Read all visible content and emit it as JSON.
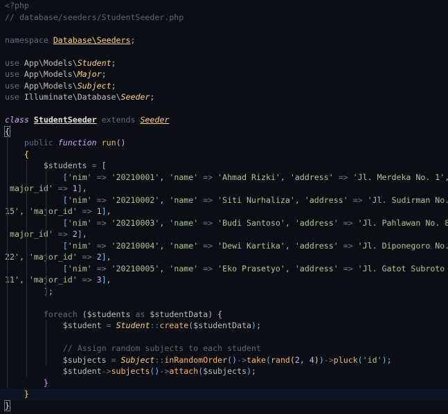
{
  "editor": {
    "lines": [
      [
        {
          "t": "<?php",
          "c": "c-comment"
        }
      ],
      [
        {
          "t": "// database/seeders/StudentSeeder.php",
          "c": "c-comment"
        }
      ],
      [],
      [
        {
          "t": "namespace ",
          "c": "c-kw"
        },
        {
          "t": "Database\\Seeders",
          "c": "c-ns"
        },
        {
          "t": ";",
          "c": "c-punc"
        }
      ],
      [],
      [
        {
          "t": "use ",
          "c": "c-kw"
        },
        {
          "t": "App\\Models\\",
          "c": "c-ident"
        },
        {
          "t": "Student",
          "c": "c-cls"
        },
        {
          "t": ";",
          "c": "c-punc"
        }
      ],
      [
        {
          "t": "use ",
          "c": "c-kw"
        },
        {
          "t": "App\\Models\\",
          "c": "c-ident"
        },
        {
          "t": "Major",
          "c": "c-cls"
        },
        {
          "t": ";",
          "c": "c-punc"
        }
      ],
      [
        {
          "t": "use ",
          "c": "c-kw"
        },
        {
          "t": "App\\Models\\",
          "c": "c-ident"
        },
        {
          "t": "Subject",
          "c": "c-cls"
        },
        {
          "t": ";",
          "c": "c-punc"
        }
      ],
      [
        {
          "t": "use ",
          "c": "c-kw"
        },
        {
          "t": "Illuminate\\Database\\",
          "c": "c-ident"
        },
        {
          "t": "Seeder",
          "c": "c-cls"
        },
        {
          "t": ";",
          "c": "c-punc"
        }
      ],
      [],
      [
        {
          "t": "class ",
          "c": "c-kwi"
        },
        {
          "t": "StudentSeeder",
          "c": "c-clsdef"
        },
        {
          "t": " extends ",
          "c": "c-kw"
        },
        {
          "t": "Seeder",
          "c": "c-clsu"
        }
      ],
      [
        {
          "t": "{",
          "c": "c-brace cursor-brace"
        }
      ],
      [
        {
          "t": "    public ",
          "c": "c-kw"
        },
        {
          "t": "function ",
          "c": "c-kwi"
        },
        {
          "t": "run",
          "c": "c-fn"
        },
        {
          "t": "()",
          "c": "c-bracket2"
        }
      ],
      [
        {
          "t": "    {",
          "c": "c-bracket1"
        }
      ],
      [
        {
          "t": "        $students",
          "c": "c-var"
        },
        {
          "t": " = ",
          "c": "c-op"
        },
        {
          "t": "[",
          "c": "c-bracket2"
        }
      ],
      [
        {
          "t": "            [",
          "c": "c-bracket3"
        },
        {
          "t": "'nim'",
          "c": "c-str"
        },
        {
          "t": " => ",
          "c": "c-op"
        },
        {
          "t": "'20210001'",
          "c": "c-str"
        },
        {
          "t": ", ",
          "c": "c-punc"
        },
        {
          "t": "'name'",
          "c": "c-str"
        },
        {
          "t": " => ",
          "c": "c-op"
        },
        {
          "t": "'Ahmad Rizki'",
          "c": "c-str"
        },
        {
          "t": ", ",
          "c": "c-punc"
        },
        {
          "t": "'address'",
          "c": "c-str"
        },
        {
          "t": " => ",
          "c": "c-op"
        },
        {
          "t": "'Jl. Merdeka No. 1'",
          "c": "c-str"
        },
        {
          "t": ",",
          "c": "c-punc"
        }
      ],
      [
        {
          "t": "'major_id'",
          "c": "c-str"
        },
        {
          "t": " => ",
          "c": "c-op"
        },
        {
          "t": "1",
          "c": "c-num"
        },
        {
          "t": "]",
          "c": "c-bracket3"
        },
        {
          "t": ",",
          "c": "c-punc"
        }
      ],
      [
        {
          "t": "            [",
          "c": "c-bracket3"
        },
        {
          "t": "'nim'",
          "c": "c-str"
        },
        {
          "t": " => ",
          "c": "c-op"
        },
        {
          "t": "'20210002'",
          "c": "c-str"
        },
        {
          "t": ", ",
          "c": "c-punc"
        },
        {
          "t": "'name'",
          "c": "c-str"
        },
        {
          "t": " => ",
          "c": "c-op"
        },
        {
          "t": "'Siti Nurhaliza'",
          "c": "c-str"
        },
        {
          "t": ", ",
          "c": "c-punc"
        },
        {
          "t": "'address'",
          "c": "c-str"
        },
        {
          "t": " => ",
          "c": "c-op"
        },
        {
          "t": "'Jl. Sudirman No.",
          "c": "c-str"
        }
      ],
      [
        {
          "t": "15'",
          "c": "c-str"
        },
        {
          "t": ", ",
          "c": "c-punc"
        },
        {
          "t": "'major_id'",
          "c": "c-str"
        },
        {
          "t": " => ",
          "c": "c-op"
        },
        {
          "t": "1",
          "c": "c-num"
        },
        {
          "t": "]",
          "c": "c-bracket3"
        },
        {
          "t": ",",
          "c": "c-punc"
        }
      ],
      [
        {
          "t": "            [",
          "c": "c-bracket3"
        },
        {
          "t": "'nim'",
          "c": "c-str"
        },
        {
          "t": " => ",
          "c": "c-op"
        },
        {
          "t": "'20210003'",
          "c": "c-str"
        },
        {
          "t": ", ",
          "c": "c-punc"
        },
        {
          "t": "'name'",
          "c": "c-str"
        },
        {
          "t": " => ",
          "c": "c-op"
        },
        {
          "t": "'Budi Santoso'",
          "c": "c-str"
        },
        {
          "t": ", ",
          "c": "c-punc"
        },
        {
          "t": "'address'",
          "c": "c-str"
        },
        {
          "t": " => ",
          "c": "c-op"
        },
        {
          "t": "'Jl. Pahlawan No. 8'",
          "c": "c-str"
        },
        {
          "t": ",",
          "c": "c-punc"
        }
      ],
      [
        {
          "t": "'major_id'",
          "c": "c-str"
        },
        {
          "t": " => ",
          "c": "c-op"
        },
        {
          "t": "2",
          "c": "c-num"
        },
        {
          "t": "]",
          "c": "c-bracket3"
        },
        {
          "t": ",",
          "c": "c-punc"
        }
      ],
      [
        {
          "t": "            [",
          "c": "c-bracket3"
        },
        {
          "t": "'nim'",
          "c": "c-str"
        },
        {
          "t": " => ",
          "c": "c-op"
        },
        {
          "t": "'20210004'",
          "c": "c-str"
        },
        {
          "t": ", ",
          "c": "c-punc"
        },
        {
          "t": "'name'",
          "c": "c-str"
        },
        {
          "t": " => ",
          "c": "c-op"
        },
        {
          "t": "'Dewi Kartika'",
          "c": "c-str"
        },
        {
          "t": ", ",
          "c": "c-punc"
        },
        {
          "t": "'address'",
          "c": "c-str"
        },
        {
          "t": " => ",
          "c": "c-op"
        },
        {
          "t": "'Jl. Diponegoro No.",
          "c": "c-str"
        }
      ],
      [
        {
          "t": "22'",
          "c": "c-str"
        },
        {
          "t": ", ",
          "c": "c-punc"
        },
        {
          "t": "'major_id'",
          "c": "c-str"
        },
        {
          "t": " => ",
          "c": "c-op"
        },
        {
          "t": "2",
          "c": "c-num"
        },
        {
          "t": "]",
          "c": "c-bracket3"
        },
        {
          "t": ",",
          "c": "c-punc"
        }
      ],
      [
        {
          "t": "            [",
          "c": "c-bracket3"
        },
        {
          "t": "'nim'",
          "c": "c-str"
        },
        {
          "t": " => ",
          "c": "c-op"
        },
        {
          "t": "'20210005'",
          "c": "c-str"
        },
        {
          "t": ", ",
          "c": "c-punc"
        },
        {
          "t": "'name'",
          "c": "c-str"
        },
        {
          "t": " => ",
          "c": "c-op"
        },
        {
          "t": "'Eko Prasetyo'",
          "c": "c-str"
        },
        {
          "t": ", ",
          "c": "c-punc"
        },
        {
          "t": "'address'",
          "c": "c-str"
        },
        {
          "t": " => ",
          "c": "c-op"
        },
        {
          "t": "'Jl. Gatot Subroto No.",
          "c": "c-str"
        }
      ],
      [
        {
          "t": "11'",
          "c": "c-str"
        },
        {
          "t": ", ",
          "c": "c-punc"
        },
        {
          "t": "'major_id'",
          "c": "c-str"
        },
        {
          "t": " => ",
          "c": "c-op"
        },
        {
          "t": "3",
          "c": "c-num"
        },
        {
          "t": "]",
          "c": "c-bracket3"
        },
        {
          "t": ",",
          "c": "c-punc"
        }
      ],
      [
        {
          "t": "        ]",
          "c": "c-bracket2"
        },
        {
          "t": ";",
          "c": "c-punc"
        }
      ],
      [],
      [
        {
          "t": "        foreach ",
          "c": "c-kw"
        },
        {
          "t": "(",
          "c": "c-bracket2"
        },
        {
          "t": "$students",
          "c": "c-var"
        },
        {
          "t": " as ",
          "c": "c-kw"
        },
        {
          "t": "$studentData",
          "c": "c-var"
        },
        {
          "t": ")",
          "c": "c-bracket2"
        },
        {
          "t": " {",
          "c": "c-bracket2"
        }
      ],
      [
        {
          "t": "            $student",
          "c": "c-var"
        },
        {
          "t": " = ",
          "c": "c-op"
        },
        {
          "t": "Student",
          "c": "c-cls"
        },
        {
          "t": "::",
          "c": "c-op"
        },
        {
          "t": "create",
          "c": "c-fn"
        },
        {
          "t": "(",
          "c": "c-bracket3"
        },
        {
          "t": "$studentData",
          "c": "c-var"
        },
        {
          "t": ")",
          "c": "c-bracket3"
        },
        {
          "t": ";",
          "c": "c-punc"
        }
      ],
      [],
      [
        {
          "t": "            // Assign random subjects to each student",
          "c": "c-comment"
        }
      ],
      [
        {
          "t": "            $subjects",
          "c": "c-var"
        },
        {
          "t": " = ",
          "c": "c-op"
        },
        {
          "t": "Subject",
          "c": "c-cls"
        },
        {
          "t": "::",
          "c": "c-op"
        },
        {
          "t": "inRandomOrder",
          "c": "c-fn"
        },
        {
          "t": "()",
          "c": "c-bracket3"
        },
        {
          "t": "->",
          "c": "c-op"
        },
        {
          "t": "take",
          "c": "c-fn"
        },
        {
          "t": "(",
          "c": "c-bracket3"
        },
        {
          "t": "rand",
          "c": "c-fn"
        },
        {
          "t": "(",
          "c": "c-bracket1"
        },
        {
          "t": "2",
          "c": "c-num"
        },
        {
          "t": ", ",
          "c": "c-punc"
        },
        {
          "t": "4",
          "c": "c-num"
        },
        {
          "t": ")",
          "c": "c-bracket1"
        },
        {
          "t": ")",
          "c": "c-bracket3"
        },
        {
          "t": "->",
          "c": "c-op"
        },
        {
          "t": "pluck",
          "c": "c-fn"
        },
        {
          "t": "(",
          "c": "c-bracket3"
        },
        {
          "t": "'id'",
          "c": "c-str"
        },
        {
          "t": ")",
          "c": "c-bracket3"
        },
        {
          "t": ";",
          "c": "c-punc"
        }
      ],
      [
        {
          "t": "            $student",
          "c": "c-var"
        },
        {
          "t": "->",
          "c": "c-op"
        },
        {
          "t": "subjects",
          "c": "c-fn"
        },
        {
          "t": "()",
          "c": "c-bracket3"
        },
        {
          "t": "->",
          "c": "c-op"
        },
        {
          "t": "attach",
          "c": "c-fn"
        },
        {
          "t": "(",
          "c": "c-bracket3"
        },
        {
          "t": "$subjects",
          "c": "c-var"
        },
        {
          "t": ")",
          "c": "c-bracket3"
        },
        {
          "t": ";",
          "c": "c-punc"
        }
      ],
      [
        {
          "t": "        }",
          "c": "c-bracket2"
        }
      ],
      [
        {
          "t": "    }",
          "c": "c-bracket1"
        }
      ],
      [
        {
          "t": "}",
          "c": "c-brace cursor-brace"
        }
      ]
    ],
    "active_line_index": 34,
    "indent_guides": [
      {
        "from": 12,
        "to": 33,
        "col": 0
      },
      {
        "from": 14,
        "to": 32,
        "col": 1
      },
      {
        "from": 15,
        "to": 25,
        "col": 2
      },
      {
        "from": 28,
        "to": 31,
        "col": 2
      }
    ]
  }
}
